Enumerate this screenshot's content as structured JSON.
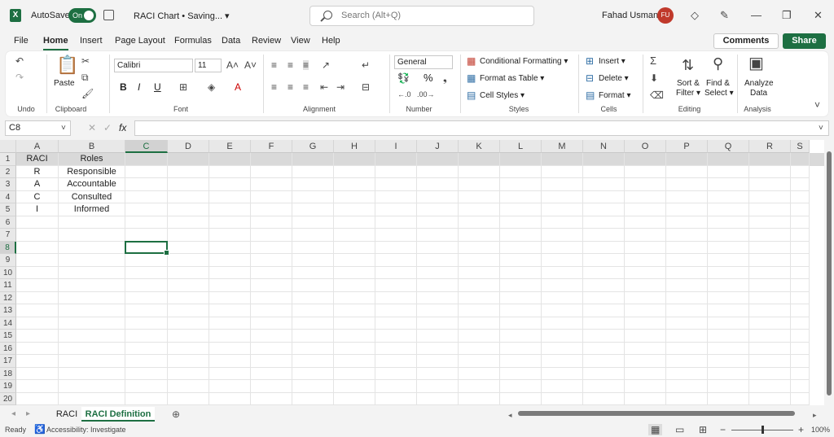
{
  "titlebar": {
    "app_icon": "X",
    "autosave_label": "AutoSave",
    "autosave_state": "On",
    "doc_title": "RACI Chart • Saving... ▾",
    "search_placeholder": "Search (Alt+Q)",
    "user_name": "Fahad Usmani",
    "user_initials": "FU"
  },
  "menu": {
    "items": [
      "File",
      "Home",
      "Insert",
      "Page Layout",
      "Formulas",
      "Data",
      "Review",
      "View",
      "Help"
    ],
    "active": "Home",
    "comments": "Comments",
    "share": "Share"
  },
  "ribbon": {
    "undo_label": "Undo",
    "clipboard": {
      "paste": "Paste",
      "label": "Clipboard"
    },
    "font": {
      "name": "Calibri",
      "size": "11",
      "bold": "B",
      "italic": "I",
      "underline": "U",
      "label": "Font"
    },
    "alignment": {
      "label": "Alignment"
    },
    "number": {
      "format": "General",
      "percent": "%",
      "label": "Number"
    },
    "styles": {
      "conditional": "Conditional Formatting ▾",
      "table": "Format as Table ▾",
      "cell": "Cell Styles ▾",
      "label": "Styles"
    },
    "cells": {
      "insert": "Insert ▾",
      "delete": "Delete ▾",
      "format": "Format ▾",
      "label": "Cells"
    },
    "editing": {
      "sort1": "Sort &",
      "sort2": "Filter ▾",
      "find1": "Find &",
      "find2": "Select ▾",
      "label": "Editing"
    },
    "analysis": {
      "btn1": "Analyze",
      "btn2": "Data",
      "label": "Analysis"
    }
  },
  "formula": {
    "namebox": "C8",
    "fx": "fx",
    "value": ""
  },
  "grid": {
    "columns": [
      "A",
      "B",
      "C",
      "D",
      "E",
      "F",
      "G",
      "H",
      "I",
      "J",
      "K",
      "L",
      "M",
      "N",
      "O",
      "P",
      "Q",
      "R",
      "S"
    ],
    "rows": [
      "1",
      "2",
      "3",
      "4",
      "5",
      "6",
      "7",
      "8",
      "9",
      "10",
      "11",
      "12",
      "13",
      "14",
      "15",
      "16",
      "17",
      "18",
      "19",
      "20"
    ],
    "data": [
      [
        "RACI",
        "Roles"
      ],
      [
        "R",
        "Responsible"
      ],
      [
        "A",
        "Accountable"
      ],
      [
        "C",
        "Consulted"
      ],
      [
        "I",
        "Informed"
      ]
    ],
    "selected": "C8"
  },
  "sheets": {
    "tabs": [
      "RACI",
      "RACI Definition"
    ],
    "active": "RACI Definition"
  },
  "status": {
    "ready": "Ready",
    "accessibility": "Accessibility: Investigate",
    "zoom": "100%"
  }
}
